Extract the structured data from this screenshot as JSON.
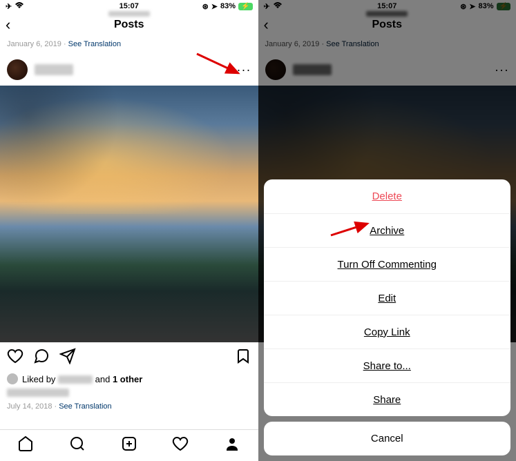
{
  "status": {
    "time": "15:07",
    "battery_pct": "83%",
    "battery_icon": "⚡"
  },
  "header": {
    "title": "Posts",
    "back": "‹"
  },
  "meta": {
    "date_top": "January 6, 2019",
    "see_translation": "See Translation",
    "sep": " · "
  },
  "post": {
    "more": "···"
  },
  "likes": {
    "prefix": "Liked by ",
    "and": " and ",
    "others": "1 other"
  },
  "footer_meta": {
    "date": "July 14, 2018",
    "see_translation": "See Translation",
    "sep": " · "
  },
  "sheet": {
    "delete": "Delete",
    "archive": "Archive",
    "turn_off_commenting": "Turn Off Commenting",
    "edit": "Edit",
    "copy_link": "Copy Link",
    "share_to": "Share to...",
    "share": "Share",
    "cancel": "Cancel"
  },
  "colors": {
    "delete": "#ed4956",
    "link": "#00376b"
  }
}
